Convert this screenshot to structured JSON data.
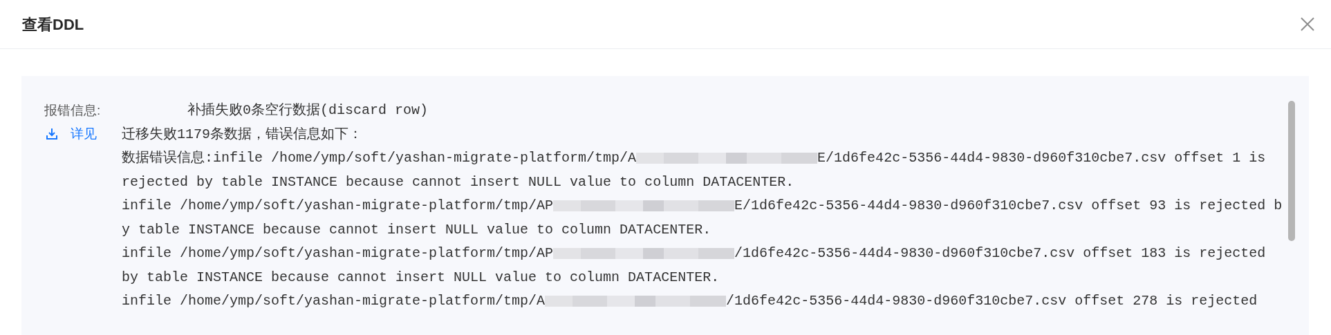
{
  "dialog": {
    "title": "查看DDL"
  },
  "error_info": {
    "label": "报错信息:",
    "detail_link": "详见",
    "lines": [
      {
        "kind": "summary",
        "text": "补插失败0条空行数据(discard row)"
      },
      {
        "kind": "plain",
        "text": "迁移失败1179条数据，错误信息如下："
      },
      {
        "kind": "redacted",
        "before": "数据错误信息:infile /home/ymp/soft/yashan-migrate-platform/tmp/A",
        "after": "E/1d6fe42c-5356-44d4-9830-d960f310cbe7.csv offset 1 is"
      },
      {
        "kind": "plain",
        "text": "rejected by table INSTANCE because cannot insert NULL value to column DATACENTER."
      },
      {
        "kind": "redacted",
        "before": "infile /home/ymp/soft/yashan-migrate-platform/tmp/AP",
        "after": "E/1d6fe42c-5356-44d4-9830-d960f310cbe7.csv offset 93 is rejected b"
      },
      {
        "kind": "plain",
        "text": "y table INSTANCE because cannot insert NULL value to column DATACENTER."
      },
      {
        "kind": "redacted",
        "before": "infile /home/ymp/soft/yashan-migrate-platform/tmp/AP",
        "after": "/1d6fe42c-5356-44d4-9830-d960f310cbe7.csv offset 183 is rejected"
      },
      {
        "kind": "plain",
        "text": "by table INSTANCE because cannot insert NULL value to column DATACENTER."
      },
      {
        "kind": "redacted",
        "before": "infile /home/ymp/soft/yashan-migrate-platform/tmp/A",
        "after": "/1d6fe42c-5356-44d4-9830-d960f310cbe7.csv offset 278 is rejected"
      }
    ]
  }
}
